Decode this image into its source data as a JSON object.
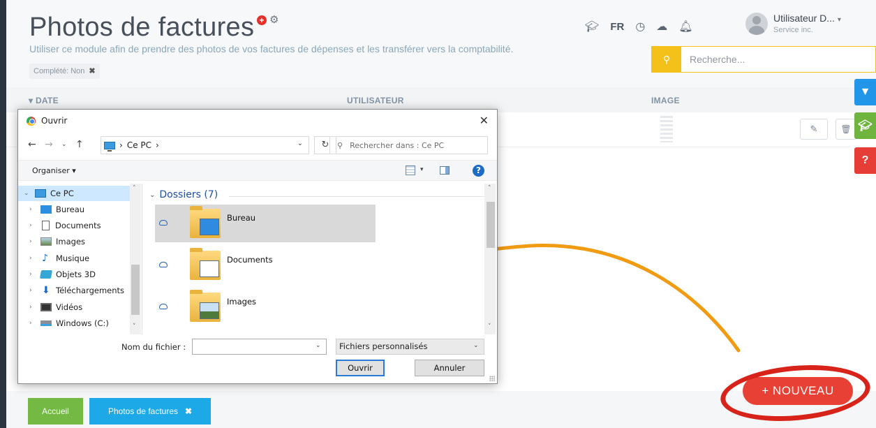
{
  "header": {
    "title": "Photos de factures",
    "subtitle": "Utiliser ce module afin de prendre des photos de vos factures de dépenses et les transférer vers la comptabilité.",
    "filter_chip": "Complété: Non",
    "lang": "FR",
    "user_name": "Utilisateur D...",
    "user_company": "Service inc.",
    "search_placeholder": "Recherche..."
  },
  "table": {
    "columns": [
      "DATE",
      "UTILISATEUR",
      "IMAGE"
    ]
  },
  "dialog": {
    "title": "Ouvrir",
    "path_root": "Ce PC",
    "search_placeholder": "Rechercher dans : Ce PC",
    "organiser": "Organiser",
    "tree": [
      "Ce PC",
      "Bureau",
      "Documents",
      "Images",
      "Musique",
      "Objets 3D",
      "Téléchargements",
      "Vidéos",
      "Windows (C:)"
    ],
    "group_label": "Dossiers (7)",
    "folders": [
      "Bureau",
      "Documents",
      "Images"
    ],
    "filename_label": "Nom du fichier :",
    "filename_value": "",
    "filetype": "Fichiers personnalisés",
    "open_label": "Ouvrir",
    "cancel_label": "Annuler"
  },
  "bottom": {
    "home": "Accueil",
    "current_tab": "Photos de factures",
    "new_button": "+ NOUVEAU"
  },
  "colors": {
    "accent_yellow": "#f4c01a",
    "new_red": "#e84034",
    "tab_blue": "#1da9e8",
    "home_green": "#73b944",
    "arrow_orange": "#f19b13"
  }
}
